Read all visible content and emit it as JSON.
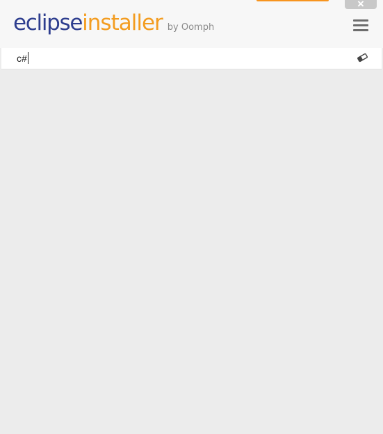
{
  "header": {
    "logo_part1": "eclipse",
    "logo_part2": "installer",
    "logo_byline": "by Oomph",
    "close_label": "×",
    "accent_color": "#f7941e"
  },
  "search": {
    "value": "c#",
    "clear_icon": "eraser-icon"
  },
  "colors": {
    "brand_blue": "#2d3d8e",
    "brand_orange": "#f39c1f"
  }
}
